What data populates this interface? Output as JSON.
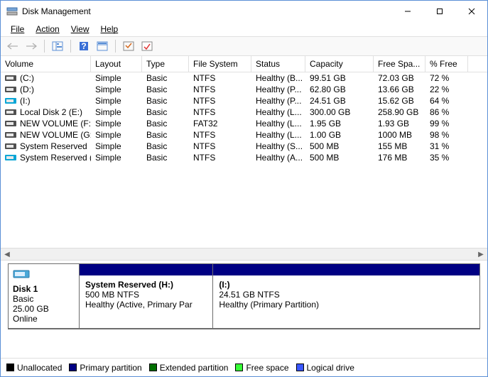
{
  "window": {
    "title": "Disk Management"
  },
  "menu": {
    "file": "File",
    "action": "Action",
    "view": "View",
    "help": "Help"
  },
  "columns": [
    "Volume",
    "Layout",
    "Type",
    "File System",
    "Status",
    "Capacity",
    "Free Spa...",
    "% Free"
  ],
  "volumes": [
    {
      "icon": "#505050",
      "name": "(C:)",
      "layout": "Simple",
      "type": "Basic",
      "fs": "NTFS",
      "status": "Healthy (B...",
      "cap": "99.51 GB",
      "free": "72.03 GB",
      "pct": "72 %"
    },
    {
      "icon": "#505050",
      "name": "(D:)",
      "layout": "Simple",
      "type": "Basic",
      "fs": "NTFS",
      "status": "Healthy (P...",
      "cap": "62.80 GB",
      "free": "13.66 GB",
      "pct": "22 %"
    },
    {
      "icon": "#0aa6d6",
      "name": "(I:)",
      "layout": "Simple",
      "type": "Basic",
      "fs": "NTFS",
      "status": "Healthy (P...",
      "cap": "24.51 GB",
      "free": "15.62 GB",
      "pct": "64 %"
    },
    {
      "icon": "#505050",
      "name": "Local Disk 2 (E:)",
      "layout": "Simple",
      "type": "Basic",
      "fs": "NTFS",
      "status": "Healthy (L...",
      "cap": "300.00 GB",
      "free": "258.90 GB",
      "pct": "86 %"
    },
    {
      "icon": "#505050",
      "name": "NEW VOLUME (F:)",
      "layout": "Simple",
      "type": "Basic",
      "fs": "FAT32",
      "status": "Healthy (L...",
      "cap": "1.95 GB",
      "free": "1.93 GB",
      "pct": "99 %"
    },
    {
      "icon": "#505050",
      "name": "NEW VOLUME (G:)",
      "layout": "Simple",
      "type": "Basic",
      "fs": "NTFS",
      "status": "Healthy (L...",
      "cap": "1.00 GB",
      "free": "1000 MB",
      "pct": "98 %"
    },
    {
      "icon": "#505050",
      "name": "System Reserved",
      "layout": "Simple",
      "type": "Basic",
      "fs": "NTFS",
      "status": "Healthy (S...",
      "cap": "500 MB",
      "free": "155 MB",
      "pct": "31 %"
    },
    {
      "icon": "#0aa6d6",
      "name": "System Reserved (...",
      "layout": "Simple",
      "type": "Basic",
      "fs": "NTFS",
      "status": "Healthy (A...",
      "cap": "500 MB",
      "free": "176 MB",
      "pct": "35 %"
    }
  ],
  "disk": {
    "label": "Disk 1",
    "type": "Basic",
    "size": "25.00 GB",
    "state": "Online",
    "parts": [
      {
        "name": "System Reserved  (H:)",
        "line2": "500 MB NTFS",
        "line3": "Healthy (Active, Primary Par",
        "band": "#000083",
        "flexw": "1"
      },
      {
        "name": "(I:)",
        "line2": "24.51 GB NTFS",
        "line3": "Healthy (Primary Partition)",
        "band": "#000083",
        "flexw": "2"
      }
    ]
  },
  "legend": [
    {
      "label": "Unallocated",
      "color": "#000000"
    },
    {
      "label": "Primary partition",
      "color": "#000083"
    },
    {
      "label": "Extended partition",
      "color": "#006f00"
    },
    {
      "label": "Free space",
      "color": "#37ff37"
    },
    {
      "label": "Logical drive",
      "color": "#3a57ff"
    }
  ]
}
